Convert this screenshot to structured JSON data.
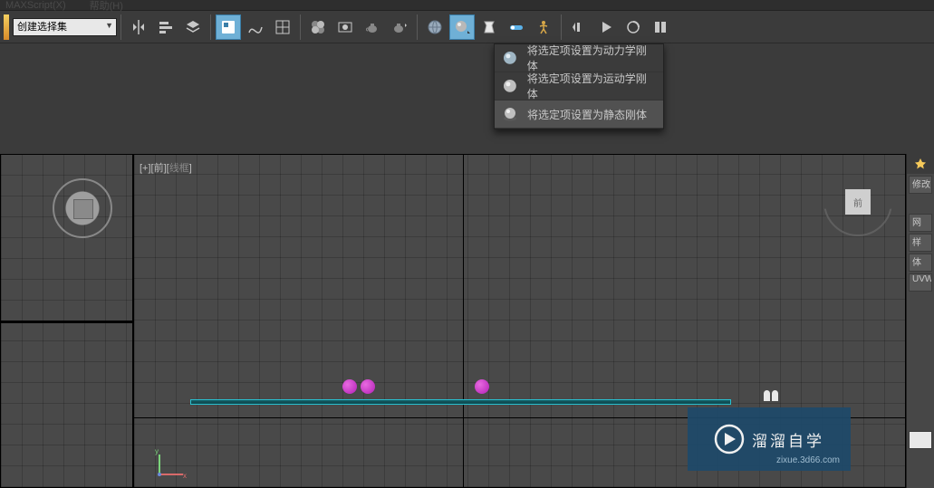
{
  "menu": {
    "maxscript": "MAXScript(X)",
    "help": "帮助(H)"
  },
  "toolbar": {
    "selection_set_placeholder": "创建选择集"
  },
  "dropdown": {
    "items": [
      {
        "label": "将选定项设置为动力学刚体",
        "icon": "sphere-blue"
      },
      {
        "label": "将选定项设置为运动学刚体",
        "icon": "sphere-grey"
      },
      {
        "label": "将选定项设置为静态刚体",
        "icon": "sphere-static"
      }
    ]
  },
  "viewport": {
    "label_prefix": "[+][前][",
    "label_wire": "线框",
    "label_suffix": "]",
    "cube_face": "前"
  },
  "rightpanel": {
    "items": [
      "修改",
      "网",
      "样",
      "体",
      "UVW"
    ]
  },
  "watermark": {
    "title": "溜溜自学",
    "url": "zixue.3d66.com"
  }
}
